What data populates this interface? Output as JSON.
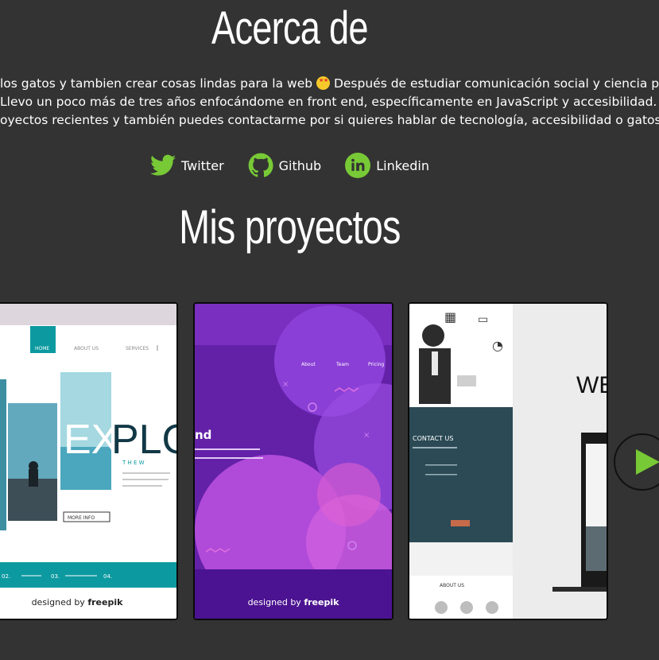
{
  "about": {
    "title": "Acerca de",
    "bio_line1_a": "los gatos y tambien crear cosas lindas para la web",
    "bio_line1_b": "Después de estudiar comunicación social y ciencia política",
    "bio_line2": "Llevo un poco más de tres años enfocándome en front end, específicamente en JavaScript y accesibilidad. Sueñ",
    "bio_line3": "oyectos recientes y también puedes contactarme por si quieres hablar de tecnología, accesibilidad o gatos!",
    "emoji_icon": "star-struck-emoji"
  },
  "social": [
    {
      "label": "Twitter",
      "icon": "twitter-icon"
    },
    {
      "label": "Github",
      "icon": "github-icon"
    },
    {
      "label": "Linkedin",
      "icon": "linkedin-icon"
    }
  ],
  "projects": {
    "title": "Mis proyectos",
    "cards": [
      {
        "nav_home": "HOME",
        "nav_about": "ABOUT US",
        "nav_services": "SERVICES",
        "hero_word_a": "EX",
        "hero_word_b": "PLO",
        "subtitle_letters": "T  H  E  W",
        "more_button": "MORE INFO",
        "pager_a": "02.",
        "pager_b": "03.",
        "pager_c": "04.",
        "credit_prefix": "designed by",
        "credit_brand": "freepik"
      },
      {
        "nav_about": "About",
        "nav_team": "Team",
        "nav_pricing": "Pricing",
        "heading_fragment": "nd",
        "credit_prefix": "designed by",
        "credit_brand": "freepik"
      },
      {
        "section_label": "CONTACT US",
        "big_text": "WE",
        "footer_label": "ABOUT US"
      }
    ],
    "next_button_icon": "play-arrow-icon"
  },
  "colors": {
    "background": "#333333",
    "accent_green": "#78c936",
    "teal": "#0c9aa0",
    "purple": "#5c1c9e"
  }
}
